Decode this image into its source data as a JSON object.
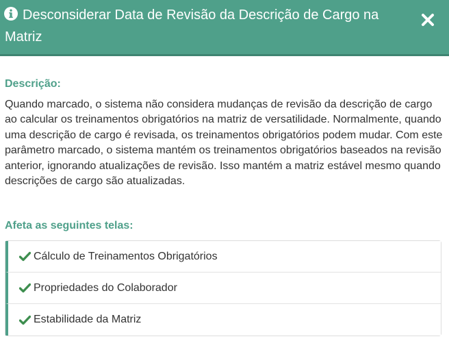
{
  "modal": {
    "title": "Desconsiderar Data de Revisão da Descrição de Cargo na Matriz",
    "close_label": "×"
  },
  "description": {
    "label": "Descrição:",
    "text": "Quando marcado, o sistema não considera mudanças de revisão da descrição de cargo ao calcular os treinamentos obrigatórios na matriz de versatilidade. Normalmente, quando uma descrição de cargo é revisada, os treinamentos obrigatórios podem mudar. Com este parâmetro marcado, o sistema mantém os treinamentos obrigatórios baseados na revisão anterior, ignorando atualizações de revisão. Isso mantém a matriz estável mesmo quando descrições de cargo são atualizadas."
  },
  "affects": {
    "label": "Afeta as seguintes telas:",
    "screens": [
      {
        "label": "Cálculo de Treinamentos Obrigatórios",
        "icon": "check-icon"
      },
      {
        "label": "Propriedades do Colaborador",
        "icon": "check-icon"
      },
      {
        "label": "Estabilidade da Matriz",
        "icon": "check-icon"
      }
    ]
  },
  "colors": {
    "header": "#4fa08a",
    "accent": "#4fa08a",
    "check": "#3e8e4f",
    "text": "#333333"
  },
  "icons": {
    "header": "info-circle-icon",
    "close": "close-icon"
  }
}
